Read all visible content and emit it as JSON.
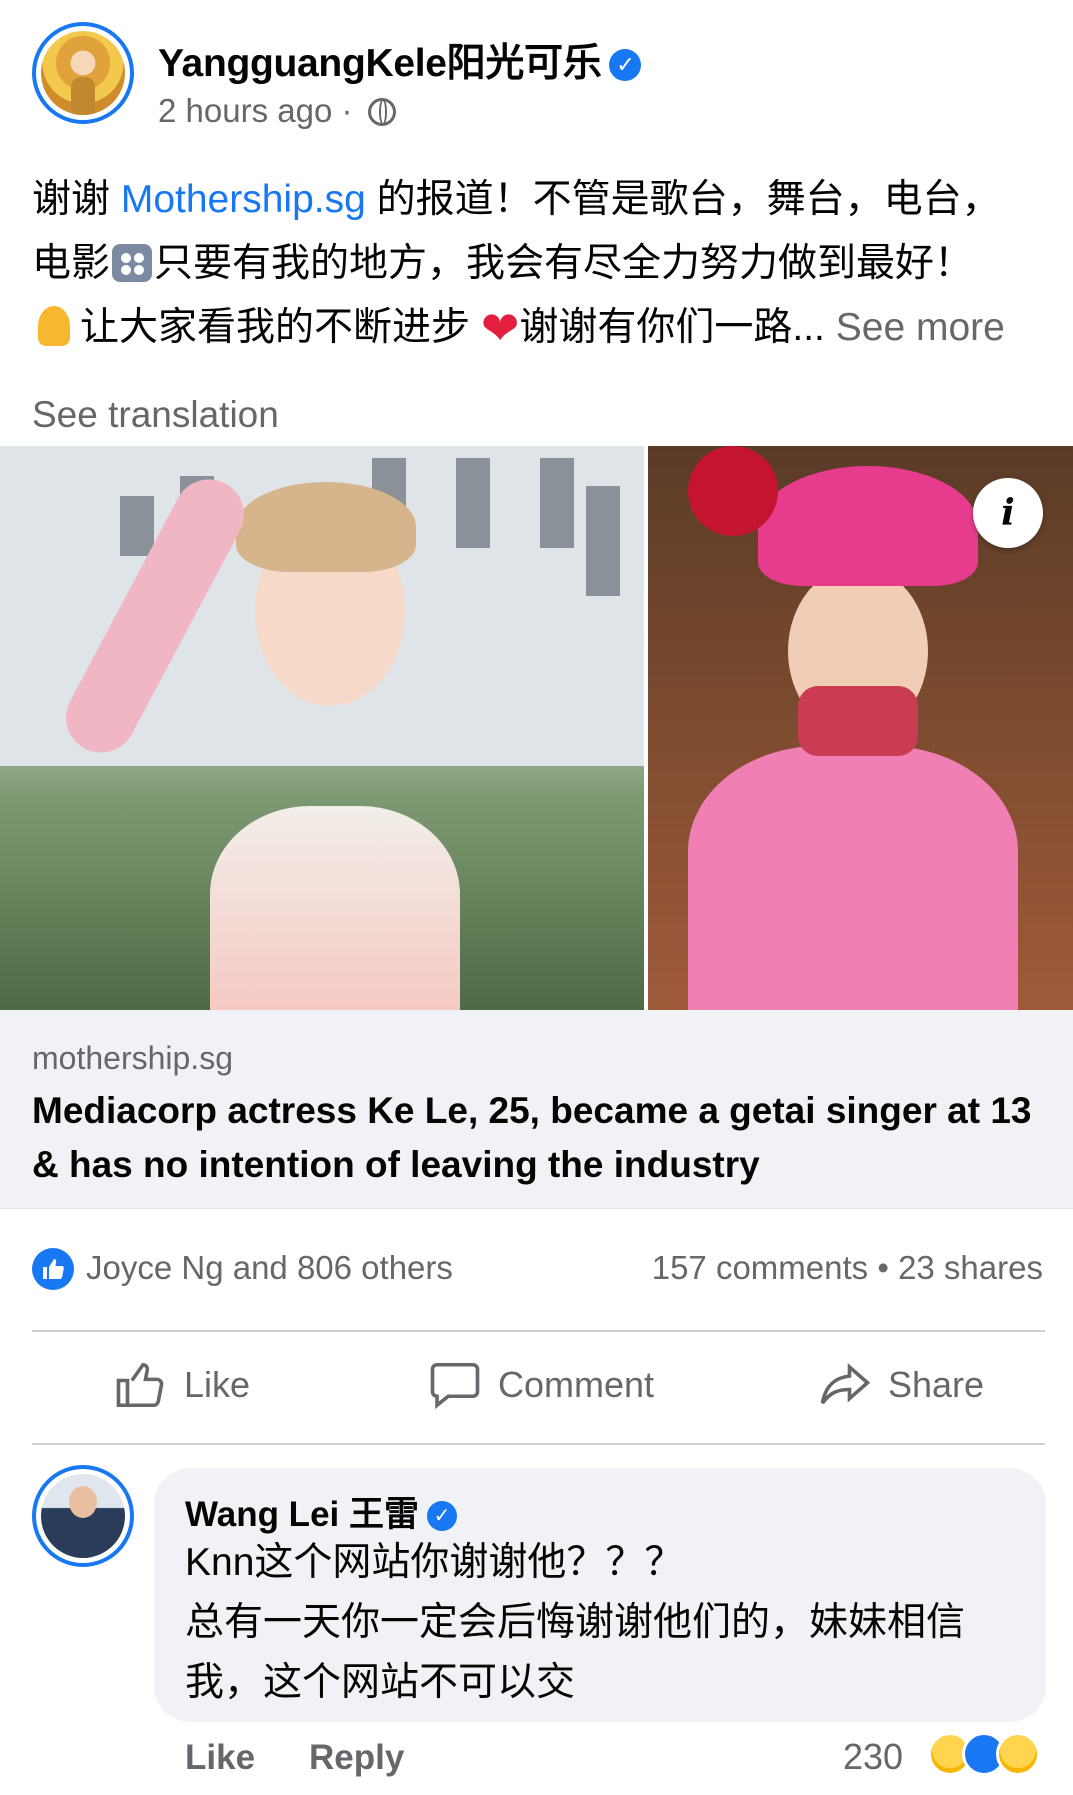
{
  "post": {
    "author": "YangguangKele阳光可乐",
    "time": "2 hours ago",
    "separator": "·",
    "text_line1_a": "谢谢 ",
    "text_link": "Mothership.sg",
    "text_line1_b": " 的报道！不管是歌台，舞台，电台，",
    "text_line2_a": "电影",
    "text_line2_b": "只要有我的地方，我会有尽全力努力做到最好！",
    "text_line3_a": "让大家看我的不断进步 ",
    "text_line3_b": "谢谢有你们一路...",
    "see_more": "See more",
    "see_translation": "See translation"
  },
  "link_preview": {
    "domain": "mothership.sg",
    "headline": "Mediacorp actress Ke Le, 25, became a getai singer at 13 & has no intention of leaving the industry",
    "info_label": "i"
  },
  "stats": {
    "reactions": "Joyce Ng and 806 others",
    "comments": "157 comments",
    "dot": "•",
    "shares": "23 shares"
  },
  "actions": {
    "like": "Like",
    "comment": "Comment",
    "share": "Share"
  },
  "comment": {
    "author": "Wang Lei 王雷",
    "line1": "Knn这个网站你谢谢他？？？",
    "line2": "总有一天你一定会后悔谢谢他们的，妹妹相信",
    "line3": "我，这个网站不可以交",
    "like_label": "Like",
    "reply_label": "Reply",
    "reaction_count": "230"
  },
  "colors": {
    "accent": "#1877f2",
    "secondary_text": "#65676b",
    "heart": "#e41e3f"
  }
}
